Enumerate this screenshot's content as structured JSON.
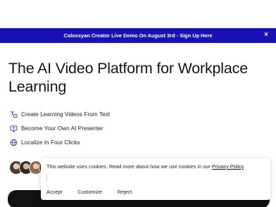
{
  "banner": {
    "text": "Colossyan Creator Live Demo On August 3rd - Sign Up Here",
    "close_glyph": "×"
  },
  "hero": {
    "headline": "The AI Video Platform for Workplace Learning"
  },
  "features": [
    {
      "label": "Create Learning Videos From Text",
      "icon": "text-to-video-icon"
    },
    {
      "label": "Become Your Own AI Presenter",
      "icon": "presenter-icon"
    },
    {
      "label": "Localize In Four Clicks",
      "icon": "globe-icon"
    }
  ],
  "cookie_banner": {
    "message": "This website uses cookies. Read more about how we use cookies in our ",
    "link": "Privacy Policy",
    "buttons": {
      "accept": "Accept",
      "customize": "Customize",
      "reject": "Reject"
    }
  },
  "colors": {
    "banner_bg": "#1a10b8",
    "cta_bg": "#121212"
  }
}
